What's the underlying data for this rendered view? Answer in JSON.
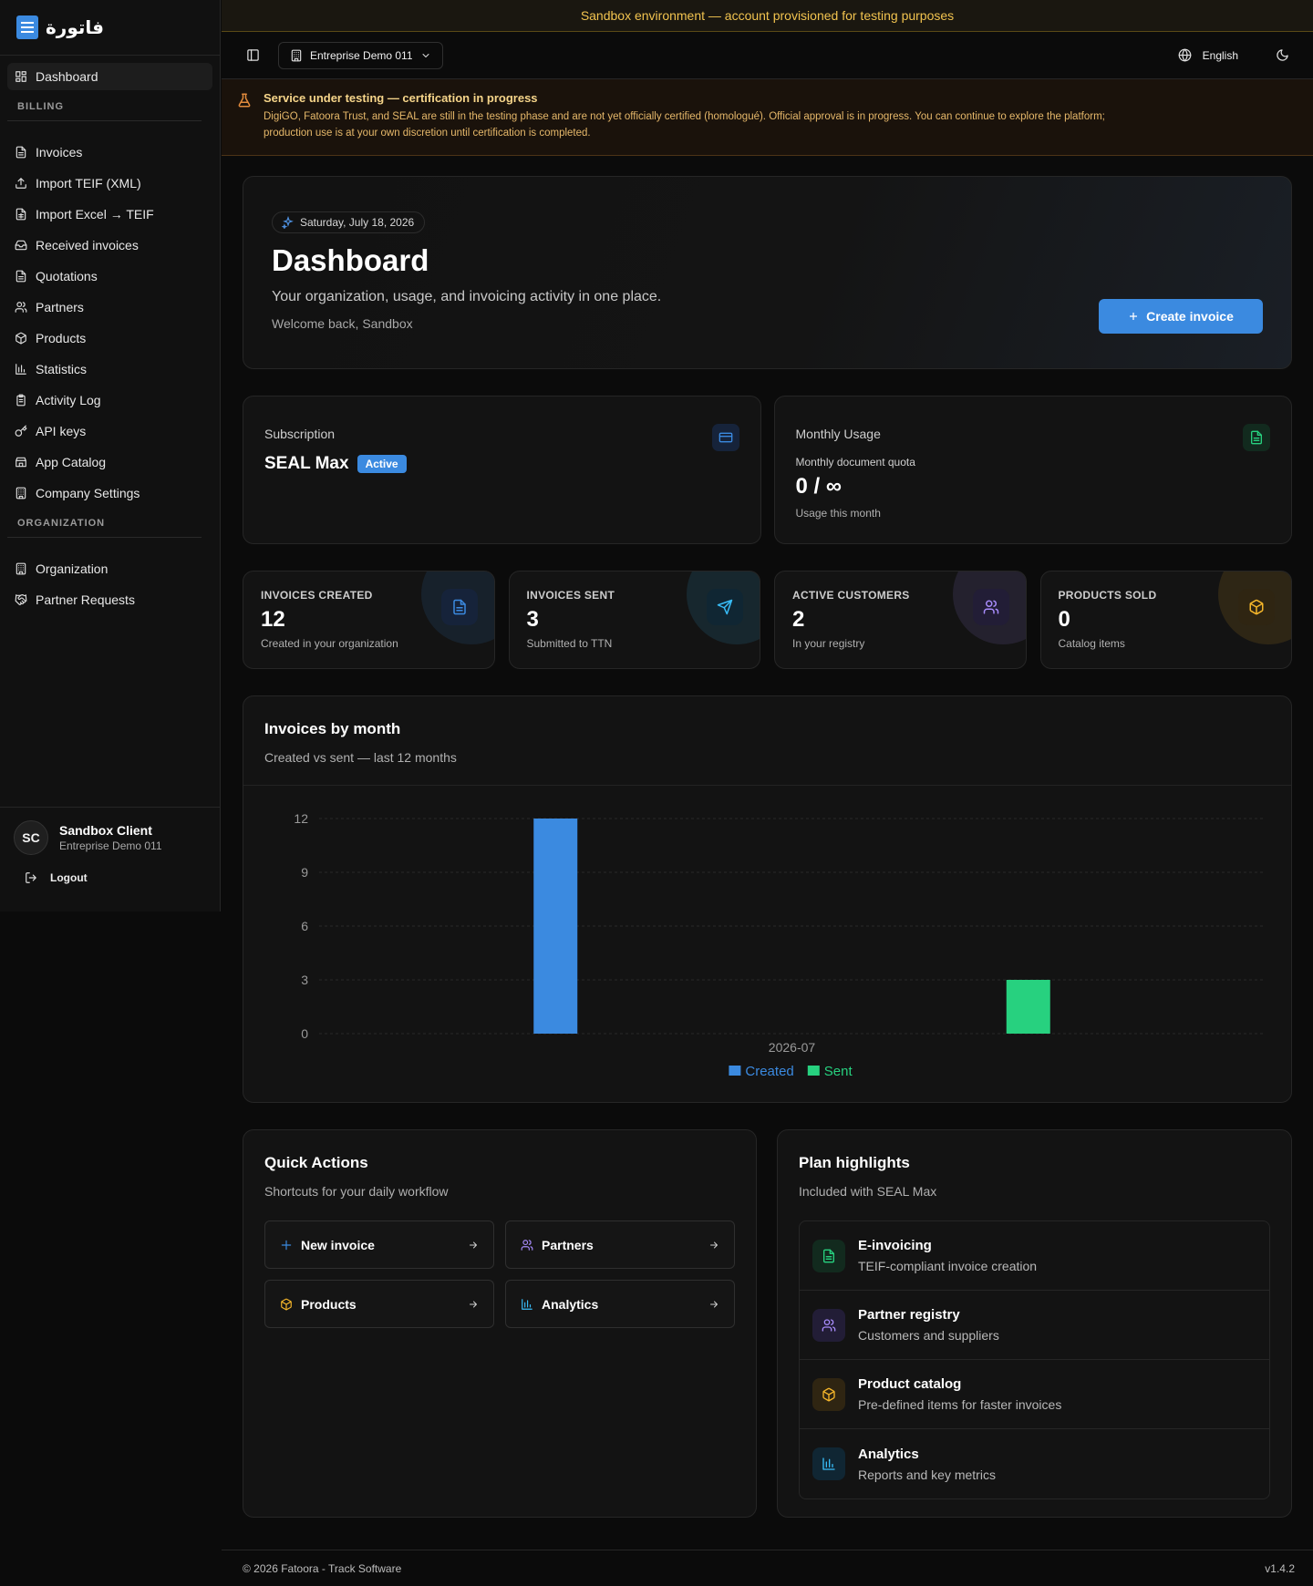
{
  "app": {
    "logo_text": "فاتورة"
  },
  "sidebar": {
    "items_top": [
      {
        "label": "Dashboard",
        "icon": "dashboard-icon"
      }
    ],
    "section_billing": "BILLING",
    "billing_items": [
      {
        "label": "Invoices",
        "icon": "file-text-icon"
      },
      {
        "label": "Import TEIF (XML)",
        "icon": "upload-icon"
      },
      {
        "label": "Import Excel → TEIF",
        "icon": "file-spreadsheet-icon"
      },
      {
        "label": "Received invoices",
        "icon": "inbox-icon"
      },
      {
        "label": "Quotations",
        "icon": "file-text-icon"
      },
      {
        "label": "Partners",
        "icon": "users-icon"
      },
      {
        "label": "Products",
        "icon": "package-icon"
      },
      {
        "label": "Statistics",
        "icon": "bar-chart-icon"
      },
      {
        "label": "Activity Log",
        "icon": "clipboard-icon"
      },
      {
        "label": "API keys",
        "icon": "key-icon"
      },
      {
        "label": "App Catalog",
        "icon": "store-icon"
      },
      {
        "label": "Company Settings",
        "icon": "building-icon"
      }
    ],
    "section_org": "ORGANIZATION",
    "org_items": [
      {
        "label": "Organization",
        "icon": "building-icon"
      },
      {
        "label": "Partner Requests",
        "icon": "handshake-icon"
      }
    ],
    "user": {
      "initials": "SC",
      "name": "Sandbox Client",
      "org": "Entreprise Demo 011"
    },
    "logout_label": "Logout"
  },
  "sandbox_banner": "Sandbox environment — account provisioned for testing purposes",
  "topbar": {
    "org_name": "Entreprise Demo 011",
    "language": "English"
  },
  "alert": {
    "title": "Service under testing — certification in progress",
    "text": "DigiGO, Fatoora Trust, and SEAL are still in the testing phase and are not yet officially certified (homologué). Official approval is in progress. You can continue to explore the platform; production use is at your own discretion until certification is completed."
  },
  "hero": {
    "date": "Saturday, July 18, 2026",
    "title": "Dashboard",
    "subtitle": "Your organization, usage, and invoicing activity in one place.",
    "welcome": "Welcome back, Sandbox",
    "create_label": "Create invoice"
  },
  "subscription": {
    "label": "Subscription",
    "plan": "SEAL Max",
    "badge": "Active"
  },
  "usage": {
    "label": "Monthly Usage",
    "quota_label": "Monthly document quota",
    "value": "0 / ∞",
    "desc": "Usage this month"
  },
  "stats": [
    {
      "label": "INVOICES CREATED",
      "value": "12",
      "desc": "Created in your organization",
      "icon": "file-text-icon",
      "color": "#3b8ae0"
    },
    {
      "label": "INVOICES SENT",
      "value": "3",
      "desc": "Submitted to TTN",
      "icon": "send-icon",
      "color": "#38bdf8"
    },
    {
      "label": "ACTIVE CUSTOMERS",
      "value": "2",
      "desc": "In your registry",
      "icon": "users-icon",
      "color": "#a78bfa"
    },
    {
      "label": "PRODUCTS SOLD",
      "value": "0",
      "desc": "Catalog items",
      "icon": "package-icon",
      "color": "#f5b62a"
    }
  ],
  "chart_section": {
    "title": "Invoices by month",
    "subtitle": "Created vs sent — last 12 months"
  },
  "chart_data": {
    "type": "bar",
    "categories": [
      "2026-07"
    ],
    "series": [
      {
        "name": "Created",
        "values": [
          12
        ],
        "color": "#3b8ae0"
      },
      {
        "name": "Sent",
        "values": [
          3
        ],
        "color": "#27d17f"
      }
    ],
    "yticks": [
      0,
      3,
      6,
      9,
      12
    ],
    "ylim": [
      0,
      12
    ],
    "grid": true,
    "legend": "bottom-center"
  },
  "quick_actions": {
    "title": "Quick Actions",
    "subtitle": "Shortcuts for your daily workflow",
    "items": [
      {
        "label": "New invoice",
        "icon": "plus-icon",
        "color": "#3b8ae0"
      },
      {
        "label": "Partners",
        "icon": "users-icon",
        "color": "#a78bfa"
      },
      {
        "label": "Products",
        "icon": "package-icon",
        "color": "#f5b62a"
      },
      {
        "label": "Analytics",
        "icon": "bar-chart-icon",
        "color": "#38bdf8"
      }
    ]
  },
  "plan_highlights": {
    "title": "Plan highlights",
    "subtitle": "Included with SEAL Max",
    "items": [
      {
        "title": "E-invoicing",
        "desc": "TEIF-compliant invoice creation",
        "icon": "file-text-icon",
        "color": "#27d17f"
      },
      {
        "title": "Partner registry",
        "desc": "Customers and suppliers",
        "icon": "users-icon",
        "color": "#a78bfa"
      },
      {
        "title": "Product catalog",
        "desc": "Pre-defined items for faster invoices",
        "icon": "package-icon",
        "color": "#f5b62a"
      },
      {
        "title": "Analytics",
        "desc": "Reports and key metrics",
        "icon": "bar-chart-icon",
        "color": "#38bdf8"
      }
    ]
  },
  "footer": {
    "copyright": "© 2026 Fatoora - Track Software",
    "version": "v1.4.2"
  }
}
